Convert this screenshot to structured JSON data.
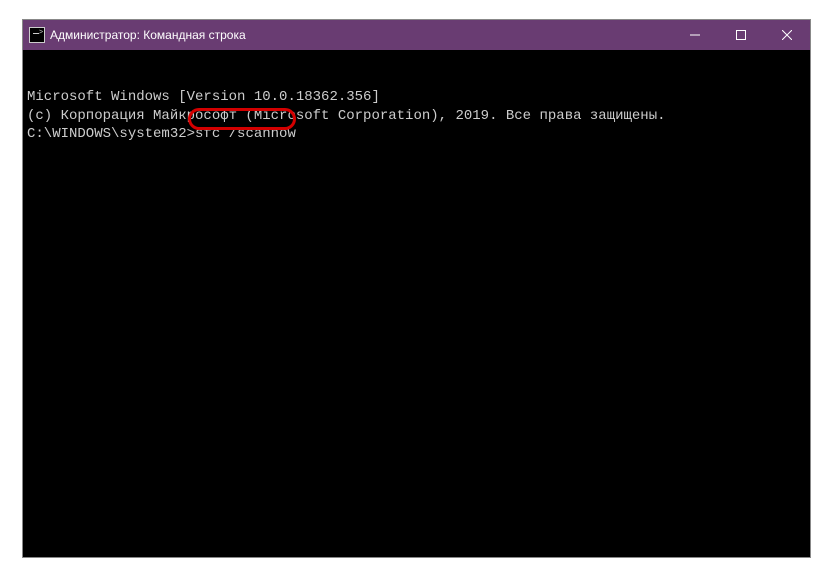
{
  "window": {
    "title": "Администратор: Командная строка"
  },
  "terminal": {
    "line1": "Microsoft Windows [Version 10.0.18362.356]",
    "line2": "(c) Корпорация Майкрософт (Microsoft Corporation), 2019. Все права защищены.",
    "blank": "",
    "prompt": "C:\\WINDOWS\\system32>",
    "command": "sfc /scannow"
  }
}
